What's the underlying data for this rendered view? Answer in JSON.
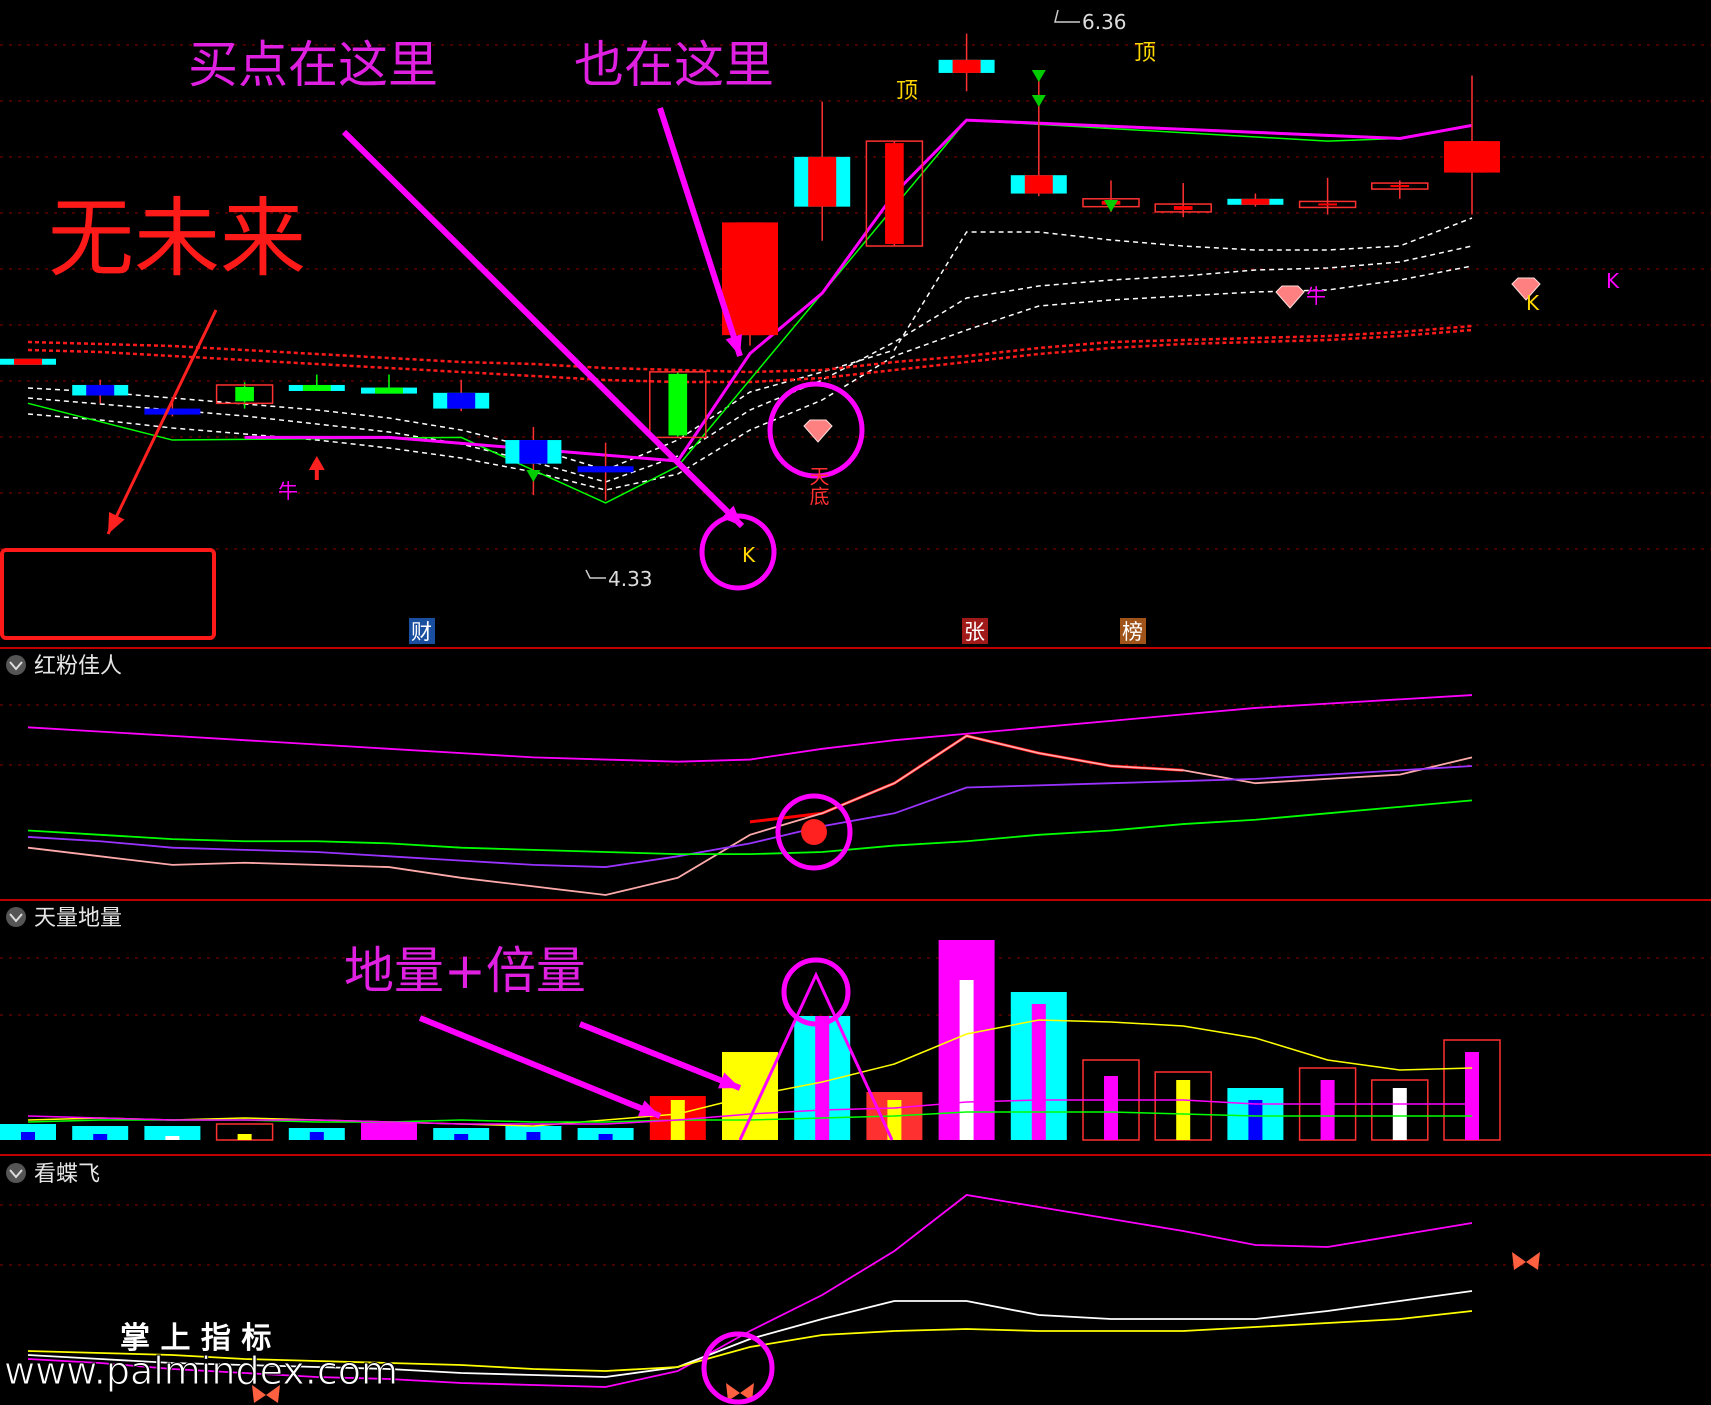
{
  "panels": {
    "main": {
      "price_high_label": "6.36",
      "price_low_label": "4.33",
      "top_labels": [
        "顶",
        "顶"
      ],
      "markers": {
        "bull": "牛",
        "k": "K",
        "tiandi": "天底"
      },
      "news_tags": [
        "财",
        "张",
        "榜"
      ]
    },
    "indicator1": {
      "title": "红粉佳人"
    },
    "indicator2": {
      "title": "天量地量"
    },
    "indicator3": {
      "title": "看蝶飞"
    }
  },
  "annotations": {
    "buy_here": "买点在这里",
    "also_here": "也在这里",
    "no_future": "无未来",
    "volume_note": "地量+倍量"
  },
  "watermark": {
    "cn": "掌 上 指 标",
    "url": "www.palmindex.com"
  },
  "colors": {
    "up": "#ff0000",
    "down": "#00ffff",
    "annotation": "#ff00ff",
    "warning": "#ff1a1a",
    "gridline": "#8b0000"
  },
  "chart_data": [
    {
      "type": "candlestick",
      "title": "",
      "ylim": [
        4.2,
        6.45
      ],
      "grid": true,
      "candles": [
        {
          "o": 5.12,
          "c": 5.12,
          "h": 5.12,
          "l": 5.12,
          "fill": "#00ffff",
          "body": "#ff0000"
        },
        {
          "o": 5.02,
          "c": 4.98,
          "h": 5.04,
          "l": 4.95,
          "fill": "#00ffff",
          "body": "#0000ff"
        },
        {
          "o": 4.93,
          "c": 4.93,
          "h": 4.97,
          "l": 4.9,
          "fill": "#0000ff",
          "body": "#0000ff"
        },
        {
          "o": 4.95,
          "c": 5.02,
          "h": 5.03,
          "l": 4.93,
          "fill": "#ff0000",
          "body": "#00ff00",
          "hollow": true
        },
        {
          "o": 5.02,
          "c": 5.02,
          "h": 5.06,
          "l": 5.0,
          "fill": "#00ffff",
          "body": "#00ff00"
        },
        {
          "o": 5.01,
          "c": 5.01,
          "h": 5.06,
          "l": 5.0,
          "fill": "#00ffff",
          "body": "#00ff00"
        },
        {
          "o": 4.99,
          "c": 4.93,
          "h": 5.04,
          "l": 4.92,
          "fill": "#00ffff",
          "body": "#0000ff"
        },
        {
          "o": 4.81,
          "c": 4.72,
          "h": 4.86,
          "l": 4.6,
          "fill": "#00ffff",
          "body": "#0000ff"
        },
        {
          "o": 4.71,
          "c": 4.7,
          "h": 4.8,
          "l": 4.58,
          "fill": "#0000ff",
          "body": "#0000ff"
        },
        {
          "o": 4.82,
          "c": 5.07,
          "h": 5.07,
          "l": 4.82,
          "fill": "#00ff00",
          "body": "#00ff00",
          "hollow": true
        },
        {
          "o": 5.21,
          "c": 5.64,
          "h": 5.64,
          "l": 5.17,
          "fill": "#ff0000",
          "body": "#ff0000"
        },
        {
          "o": 5.7,
          "c": 5.89,
          "h": 6.1,
          "l": 5.57,
          "fill": "#00ffff",
          "body": "#ff0000"
        },
        {
          "o": 5.55,
          "c": 5.95,
          "h": 5.95,
          "l": 5.55,
          "fill": "#ff0000",
          "body": "#ff0000",
          "hollow": true
        },
        {
          "o": 6.21,
          "c": 6.26,
          "h": 6.36,
          "l": 6.14,
          "fill": "#00ffff",
          "body": "#ff0000"
        },
        {
          "o": 5.82,
          "c": 5.75,
          "h": 6.2,
          "l": 5.74,
          "fill": "#00ffff",
          "body": "#ff0000"
        },
        {
          "o": 5.73,
          "c": 5.7,
          "h": 5.8,
          "l": 5.68,
          "fill": "#ff0000",
          "body": "#ff0000",
          "hollow": true
        },
        {
          "o": 5.71,
          "c": 5.68,
          "h": 5.79,
          "l": 5.66,
          "fill": "#ff0000",
          "body": "#ff0000",
          "hollow": true
        },
        {
          "o": 5.72,
          "c": 5.73,
          "h": 5.75,
          "l": 5.7,
          "fill": "#00ffff",
          "body": "#ff0000"
        },
        {
          "o": 5.72,
          "c": 5.71,
          "h": 5.81,
          "l": 5.67,
          "fill": "#ff0000",
          "body": "#ff0000",
          "hollow": true
        },
        {
          "o": 5.77,
          "c": 5.79,
          "h": 5.8,
          "l": 5.73,
          "fill": "#ff0000",
          "body": "#ff0000",
          "hollow": true
        },
        {
          "o": 5.83,
          "c": 5.95,
          "h": 6.2,
          "l": 5.67,
          "fill": "#ff0000",
          "body": "#ff0000"
        }
      ],
      "lines": [
        {
          "name": "",
          "color": "#00ff00",
          "values": [
            4.95,
            null,
            4.81,
            null,
            null,
            null,
            4.82,
            null,
            4.57,
            4.71,
            null,
            null,
            null,
            6.03,
            null,
            null,
            null,
            null,
            5.95,
            5.96,
            null
          ]
        },
        {
          "name": "",
          "color": "#ff00ff",
          "values": [
            null,
            null,
            null,
            4.82,
            null,
            4.82,
            null,
            null,
            null,
            4.73,
            5.14,
            5.37,
            5.75,
            6.03,
            null,
            null,
            null,
            null,
            null,
            5.96,
            6.01
          ]
        }
      ]
    },
    {
      "type": "line",
      "title": "红粉佳人",
      "ylim": [
        0,
        100
      ],
      "series": [
        {
          "color": "#ff00ff",
          "values": [
            78,
            76,
            74,
            72,
            70,
            68,
            66,
            64,
            63,
            62,
            63,
            68,
            72,
            75,
            78,
            81,
            84,
            87,
            89,
            91,
            93
          ]
        },
        {
          "color": "#ff0000",
          "values": [
            null,
            null,
            null,
            null,
            null,
            null,
            null,
            null,
            null,
            null,
            34,
            38,
            52,
            74,
            66,
            60,
            58,
            null,
            null,
            null,
            null
          ]
        },
        {
          "color": "#ffaaaa",
          "values": [
            22,
            18,
            14,
            15,
            14,
            13,
            8,
            4,
            0,
            8,
            28,
            38,
            52,
            74,
            66,
            60,
            58,
            52,
            54,
            56,
            64
          ]
        },
        {
          "color": "#9933ff",
          "values": [
            27,
            25,
            22,
            21,
            20,
            18,
            16,
            14,
            13,
            18,
            24,
            32,
            38,
            50,
            51,
            52,
            53,
            54,
            56,
            58,
            60
          ]
        },
        {
          "color": "#00ff00",
          "values": [
            30,
            28,
            26,
            25,
            25,
            24,
            22,
            21,
            20,
            19,
            19,
            20,
            23,
            25,
            28,
            30,
            33,
            35,
            38,
            41,
            44
          ]
        }
      ]
    },
    {
      "type": "bar",
      "title": "天量地量",
      "ylim": [
        0,
        100
      ],
      "values": [
        8,
        7,
        7,
        8,
        6,
        9,
        6,
        7,
        6,
        22,
        44,
        62,
        24,
        100,
        74,
        40,
        34,
        26,
        36,
        30,
        50
      ],
      "inner": [
        4,
        3,
        2,
        3,
        4,
        5,
        3,
        4,
        3,
        20,
        40,
        62,
        20,
        80,
        68,
        32,
        30,
        20,
        30,
        26,
        44
      ],
      "line_yellow": [
        10,
        11,
        10,
        11,
        10,
        9,
        8,
        7,
        10,
        13,
        22,
        29,
        38,
        53,
        60,
        59,
        57,
        51,
        40,
        35,
        36
      ],
      "line_green": [
        9,
        10,
        10,
        10,
        9,
        9,
        10,
        9,
        9,
        10,
        10,
        11,
        12,
        14,
        14,
        14,
        13,
        12,
        12,
        12,
        12
      ],
      "line_magenta": [
        12,
        11,
        10,
        10,
        10,
        9,
        8,
        8,
        8,
        10,
        13,
        15,
        16,
        19,
        20,
        20,
        20,
        18,
        18,
        18,
        18
      ]
    },
    {
      "type": "line",
      "title": "看蝶飞",
      "ylim": [
        0,
        100
      ],
      "series": [
        {
          "color": "#ff00ff",
          "values": [
            18,
            16,
            13,
            11,
            9,
            8,
            6,
            5,
            4,
            12,
            32,
            50,
            72,
            100,
            94,
            88,
            82,
            75,
            74,
            80,
            86
          ]
        },
        {
          "color": "#ffffff",
          "values": [
            20,
            18,
            16,
            15,
            14,
            13,
            11,
            10,
            9,
            14,
            28,
            38,
            47,
            47,
            40,
            38,
            38,
            38,
            42,
            47,
            52
          ]
        },
        {
          "color": "#ffff00",
          "values": [
            22,
            21,
            20,
            18,
            17,
            16,
            15,
            13,
            12,
            14,
            24,
            30,
            32,
            33,
            32,
            32,
            32,
            34,
            36,
            38,
            42
          ]
        }
      ]
    }
  ]
}
